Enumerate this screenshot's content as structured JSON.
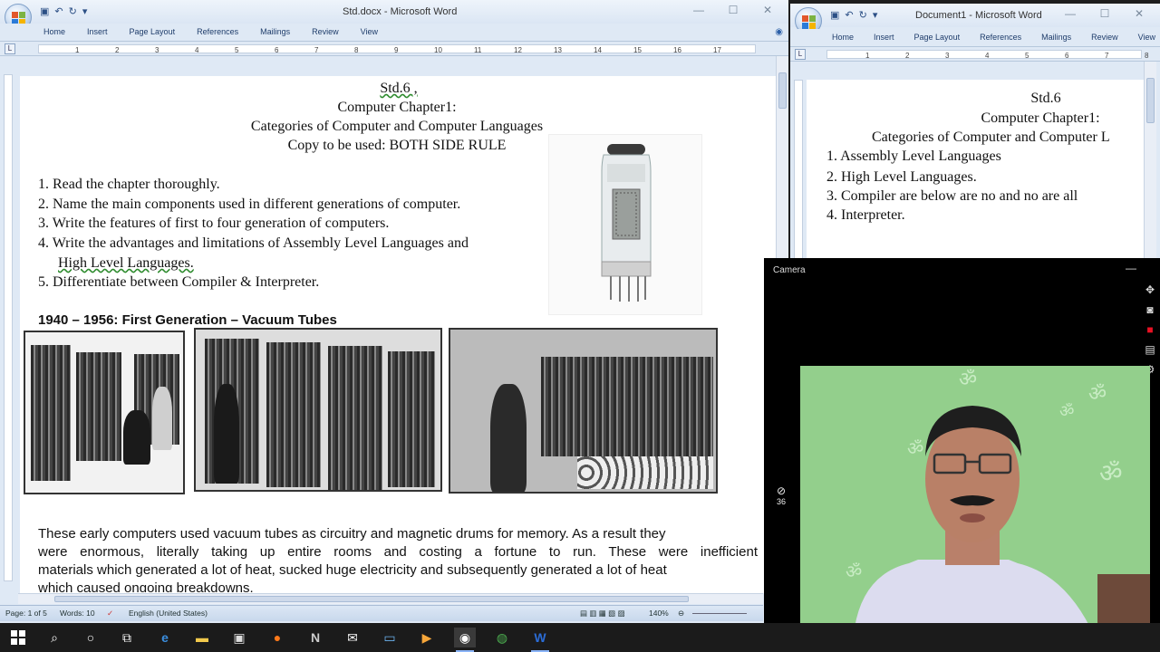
{
  "main_window": {
    "title": "Std.docx - Microsoft Word",
    "tabs": [
      "Home",
      "Insert",
      "Page Layout",
      "References",
      "Mailings",
      "Review",
      "View"
    ],
    "ruler_numbers": [
      "1",
      "2",
      "3",
      "4",
      "5",
      "6",
      "7",
      "8",
      "9",
      "10",
      "11",
      "12",
      "13",
      "14",
      "15",
      "16",
      "17"
    ],
    "document": {
      "header_lines": [
        "Std.6 ,",
        "Computer Chapter1:",
        "Categories of Computer and Computer Languages",
        "Copy to be used: BOTH SIDE RULE"
      ],
      "questions": [
        "1. Read the chapter thoroughly.",
        "2. Name the main components used in different generations of computer.",
        "3. Write the features of first to four generation of computers.",
        "4. Write the advantages and limitations of Assembly Level Languages and",
        "High Level Languages.",
        "5. Differentiate between Compiler & Interpreter."
      ],
      "section_heading": "1940 – 1956:  First Generation – Vacuum Tubes",
      "paragraph_lines": [
        "These early computers used vacuum tubes as circuitry and magnetic drums for memory. As a result they",
        "were enormous, literally taking up entire rooms and costing a fortune to run. These were inefficient",
        "materials which generated a lot of heat, sucked huge electricity and subsequently generated a lot of heat",
        "which caused ongoing breakdowns."
      ]
    },
    "status": {
      "page": "Page: 1 of 5",
      "words": "Words: 10",
      "language": "English (United States)",
      "zoom": "140%"
    }
  },
  "second_window": {
    "title": "Document1 - Microsoft Word",
    "tabs": [
      "Home",
      "Insert",
      "Page Layout",
      "References",
      "Mailings",
      "Review",
      "View"
    ],
    "ruler_numbers": [
      "1",
      "2",
      "3",
      "4",
      "5",
      "6",
      "7",
      "8",
      "9"
    ],
    "document": {
      "header_lines": [
        "Std.6",
        "Computer Chapter1:",
        "Categories of Computer and Computer L"
      ],
      "items": [
        "1. Assembly Level Languages",
        "2. High Level Languages.",
        "3. Compiler are below are no and no are all",
        "4. Interpreter."
      ]
    }
  },
  "camera": {
    "title": "Camera",
    "timer": "36"
  },
  "icons": {
    "window_controls": [
      "minimize-icon",
      "maximize-icon",
      "close-icon"
    ],
    "taskbar": [
      "windows-start-icon",
      "search-icon",
      "cortana-icon",
      "task-view-icon",
      "edge-icon",
      "file-explorer-icon",
      "store-icon",
      "firefox-icon",
      "notion-icon",
      "mail-icon",
      "photos-icon",
      "media-player-icon",
      "camera-icon",
      "chrome-icon",
      "word-icon"
    ]
  }
}
